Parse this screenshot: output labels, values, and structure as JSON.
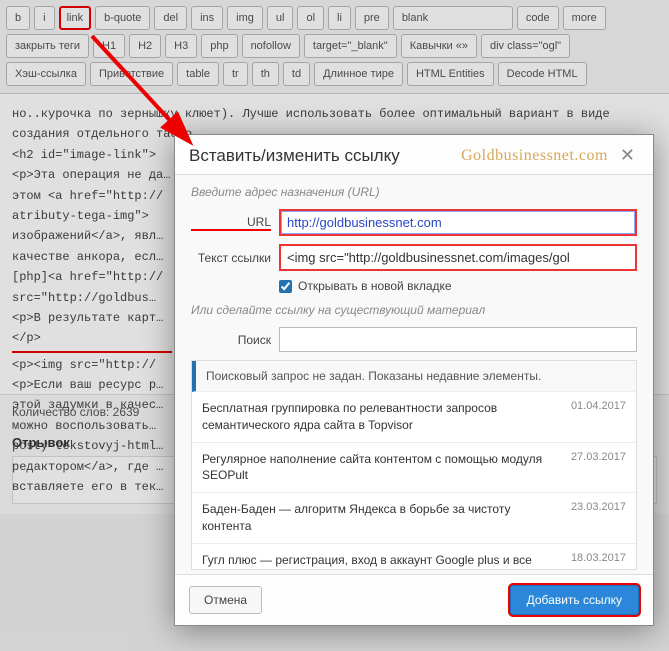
{
  "toolbar": {
    "rows": [
      [
        "b",
        "i",
        "link",
        "b-quote",
        "del",
        "ins",
        "img",
        "ul",
        "ol",
        "li",
        "pre",
        "blank",
        "code",
        "more"
      ],
      [
        "закрыть теги",
        "H1",
        "H2",
        "H3",
        "php",
        "nofollow",
        "target=\"_blank\"",
        "Кавычки «»",
        "div class=\"ogl\""
      ],
      [
        "Хэш-ссылка",
        "Приветствие",
        "table",
        "tr",
        "th",
        "td",
        "Длинное тире",
        "HTML Entities",
        "Decode HTML"
      ]
    ]
  },
  "editor": {
    "lines": [
      "но..курочка по зернышку клюет). Лучше использовать более оптимальный вариант в виде",
      "создания отдельного табло…",
      "<h2 id=\"image-link\">",
      "<p>Эта операция не да…",
      "этом <a href=\"http://",
      "atributy-tega-img\">",
      "изображений</a>, явл…",
      "качестве анкора, есл…",
      "[php]<a href=\"http://",
      "src=\"http://goldbus…",
      "<p>В результате карт…",
      "</p>",
      "<p><img src=\"http://",
      "<p>Если ваш ресурс р…",
      "этой задумки в качес…",
      "можно воспользовать…",
      "posty-tekstovyj-html…",
      "редактором</a>, где …",
      "вставляете его в тек…"
    ]
  },
  "meta": {
    "word_count_label": "Количество слов:",
    "word_count": "2639",
    "excerpt_title": "Отрывок"
  },
  "modal": {
    "title": "Вставить/изменить ссылку",
    "brand": "Goldbusinessnet.com",
    "hint": "Введите адрес назначения (URL)",
    "url_label": "URL",
    "url_value": "http://goldbusinessnet.com",
    "link_text_label": "Текст ссылки",
    "link_text_value": "<img src=\"http://goldbusinessnet.com/images/gol",
    "open_new_tab": "Открывать в новой вкладке",
    "or_existing": "Или сделайте ссылку на существующий материал",
    "search_label": "Поиск",
    "search_value": "",
    "results_header": "Поисковый запрос не задан. Показаны недавние элементы.",
    "results": [
      {
        "title": "Бесплатная группировка по релевантности запросов семантического ядра сайта в Topvisor",
        "date": "01.04.2017"
      },
      {
        "title": "Регулярное наполнение сайта контентом с помощью модуля SEOPult",
        "date": "27.03.2017"
      },
      {
        "title": "Баден-Баден — алгоритм Яндекса в борьбе за чистоту контента",
        "date": "23.03.2017"
      },
      {
        "title": "Гугл плюс — регистрация, вход в аккаунт Google plus и все возможности этой социальной сети",
        "date": "18.03.2017"
      }
    ],
    "cancel": "Отмена",
    "submit": "Добавить ссылку"
  }
}
